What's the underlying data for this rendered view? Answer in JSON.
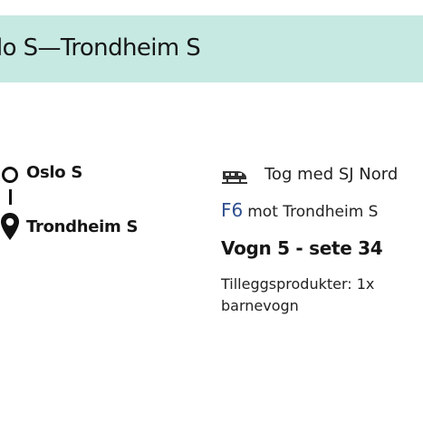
{
  "route": {
    "title": "lo S—Trondheim S"
  },
  "stops": {
    "from": "Oslo S",
    "to": "Trondheim S"
  },
  "journey": {
    "operator": "Tog med SJ Nord",
    "line_code": "F6",
    "line_destination": "mot Trondheim S",
    "seat": "Vogn 5 - sete 34",
    "extras": "Tilleggsprodukter: 1x barnevogn"
  },
  "colors": {
    "header_background": "#c6e9e1",
    "line_code": "#2f4f8f"
  },
  "icons": {
    "origin": "circle-outline-icon",
    "destination": "location-pin-icon",
    "transport": "train-icon"
  }
}
